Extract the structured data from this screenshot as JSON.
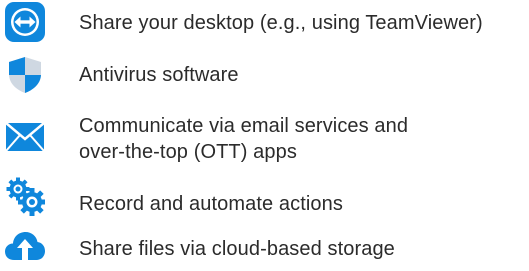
{
  "colors": {
    "accent": "#0f87dc",
    "text": "#2b2b2b",
    "shield_light": "#cfd8e2"
  },
  "items": [
    {
      "icon": "teamviewer-icon",
      "label": "Share your desktop (e.g., using TeamViewer)"
    },
    {
      "icon": "shield-icon",
      "label": "Antivirus software"
    },
    {
      "icon": "envelope-icon",
      "lines": [
        "Communicate via email services and",
        "over-the-top (OTT) apps"
      ]
    },
    {
      "icon": "gears-icon",
      "label": "Record and automate actions"
    },
    {
      "icon": "cloud-upload-icon",
      "label": "Share files via cloud-based storage"
    }
  ]
}
